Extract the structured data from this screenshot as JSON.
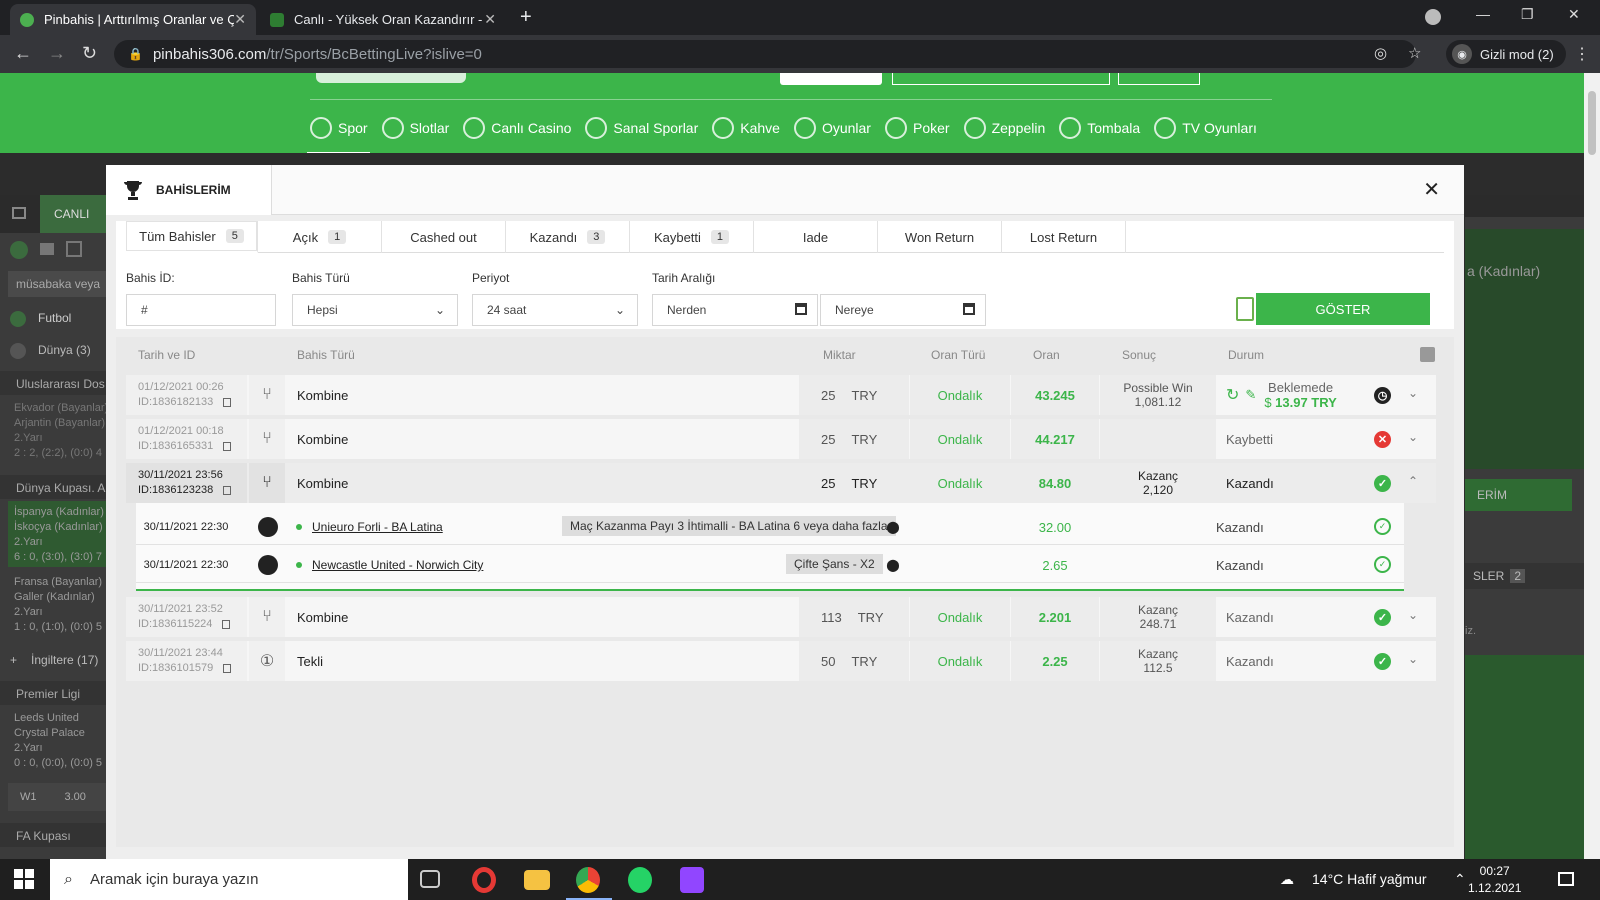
{
  "browser": {
    "tabs": [
      {
        "title": "Pinbahis | Arttırılmış Oranlar ve Ç",
        "active": true
      },
      {
        "title": "Canlı - Yüksek Oran Kazandırır - S",
        "active": false
      }
    ],
    "url_host": "pinbahis306.com",
    "url_path": "/tr/Sports/BcBettingLive?islive=0",
    "incognito_label": "Gizli mod (2)"
  },
  "site": {
    "menu": [
      {
        "label": "Spor",
        "icon": "soccer-icon",
        "active": true
      },
      {
        "label": "Slotlar",
        "icon": "slot-icon"
      },
      {
        "label": "Canlı Casino",
        "icon": "chip-icon"
      },
      {
        "label": "Sanal Sporlar",
        "icon": "virtual-icon"
      },
      {
        "label": "Kahve",
        "icon": "coffee-icon"
      },
      {
        "label": "Oyunlar",
        "icon": "games-icon"
      },
      {
        "label": "Poker",
        "icon": "poker-icon"
      },
      {
        "label": "Zeppelin",
        "icon": "zeppelin-icon"
      },
      {
        "label": "Tombala",
        "icon": "tombala-icon"
      },
      {
        "label": "TV Oyunları",
        "icon": "tv-icon"
      }
    ],
    "left": {
      "live_tab": "CANLI",
      "search_placeholder": "müsabaka veya",
      "futbol": "Futbol",
      "dunya": "Dünya (3)",
      "uluslararasi": "Uluslararası Dos",
      "m1": "Ekvador (Bayanlar)",
      "m1b": "Arjantin (Bayanlar)",
      "m1c": "2.Yarı",
      "m1d": "2 : 2, (2:2), (0:0) 4",
      "dunya_kupasi": "Dünya Kupası. A",
      "m2": "İspanya (Kadınlar)",
      "m2b": "İskoçya (Kadınlar)",
      "m2c": "2.Yarı",
      "m2d": "6 : 0, (3:0), (3:0) 7",
      "m3": "Fransa (Bayanlar)",
      "m3b": "Galler (Kadınlar)",
      "m3c": "2.Yarı",
      "m3d": "1 : 0, (1:0), (0:0) 5",
      "ingiltere": "İngiltere (17)",
      "premier": "Premier Ligi",
      "m4": "Leeds United",
      "m4b": "Crystal Palace",
      "m4c": "2.Yarı",
      "m4d": "0 : 0, (0:0), (0:0) 5",
      "w1": "W1",
      "w1odds": "3.00",
      "fa": "FA Kupası"
    },
    "right": {
      "title": "a (Kadınlar)",
      "button": "ERİM",
      "tab": "SLER",
      "tab_count": "2",
      "note": "iz."
    }
  },
  "modal": {
    "title": "BAHİSLERİM",
    "close": "✕",
    "tabs": [
      {
        "label": "Tüm Bahisler",
        "count": "5",
        "active": true
      },
      {
        "label": "Açık",
        "count": "1"
      },
      {
        "label": "Cashed out",
        "count": ""
      },
      {
        "label": "Kazandı",
        "count": "3"
      },
      {
        "label": "Kaybetti",
        "count": "1"
      },
      {
        "label": "Iade",
        "count": ""
      },
      {
        "label": "Won Return",
        "count": ""
      },
      {
        "label": "Lost Return",
        "count": ""
      }
    ],
    "filters": {
      "bet_id_label": "Bahis İD:",
      "bet_id_value": "#",
      "bet_type_label": "Bahis Türü",
      "bet_type_value": "Hepsi",
      "period_label": "Periyot",
      "period_value": "24 saat",
      "date_range_label": "Tarih Aralığı",
      "from": "Nerden",
      "to": "Nereye",
      "show_button": "GÖSTER"
    },
    "columns": {
      "date": "Tarih ve ID",
      "type": "Bahis Türü",
      "amount": "Miktar",
      "odds_type": "Oran Türü",
      "odds": "Oran",
      "result": "Sonuç",
      "status": "Durum"
    },
    "bets": [
      {
        "date": "01/12/2021 00:26",
        "id": "ID:1836182133",
        "type": "Kombine",
        "amount": "25",
        "currency": "TRY",
        "odds_type": "Ondalık",
        "odds": "43.245",
        "result_label": "Possible Win",
        "result_value": "1,081.12",
        "status": "Beklemede",
        "cashout": "13.97 TRY"
      },
      {
        "date": "01/12/2021 00:18",
        "id": "ID:1836165331",
        "type": "Kombine",
        "amount": "25",
        "currency": "TRY",
        "odds_type": "Ondalık",
        "odds": "44.217",
        "result_label": "",
        "result_value": "",
        "status": "Kaybetti"
      },
      {
        "date": "30/11/2021 23:56",
        "id": "ID:1836123238",
        "type": "Kombine",
        "amount": "25",
        "currency": "TRY",
        "odds_type": "Ondalık",
        "odds": "84.80",
        "result_label": "Kazanç",
        "result_value": "2,120",
        "status": "Kazandı"
      },
      {
        "date": "30/11/2021 23:52",
        "id": "ID:1836115224",
        "type": "Kombine",
        "amount": "113",
        "currency": "TRY",
        "odds_type": "Ondalık",
        "odds": "2.201",
        "result_label": "Kazanç",
        "result_value": "248.71",
        "status": "Kazandı"
      },
      {
        "date": "30/11/2021 23:44",
        "id": "ID:1836101579",
        "type": "Tekli",
        "amount": "50",
        "currency": "TRY",
        "odds_type": "Ondalık",
        "odds": "2.25",
        "result_label": "Kazanç",
        "result_value": "112.5",
        "status": "Kazandı"
      }
    ],
    "selections": [
      {
        "date": "30/11/2021 22:30",
        "match": "Unieuro Forli - BA Latina",
        "pick": "Maç Kazanma Payı 3 İhtimalli - BA Latina 6 veya daha fazla",
        "odds": "32.00",
        "status": "Kazandı"
      },
      {
        "date": "30/11/2021 22:30",
        "match": "Newcastle United - Norwich City",
        "pick": "Çifte Şans - X2",
        "odds": "2.65",
        "status": "Kazandı"
      }
    ]
  },
  "taskbar": {
    "search": "Aramak için buraya yazın",
    "weather": "14°C  Hafif yağmur",
    "time": "00:27",
    "date": "1.12.2021"
  }
}
